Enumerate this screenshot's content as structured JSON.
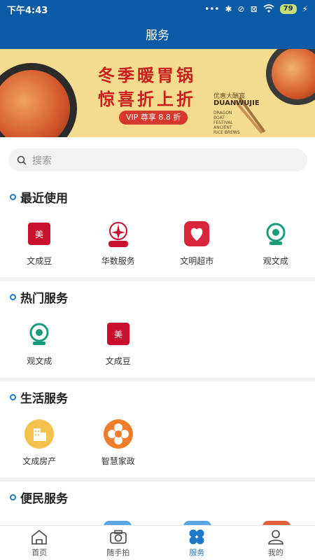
{
  "status_bar": {
    "time": "下午4:43",
    "icons": [
      "dots-icon",
      "bluetooth-icon",
      "vibrate-icon",
      "sim-icon",
      "wifi-icon",
      "battery-icon",
      "charging-icon"
    ],
    "battery": "79"
  },
  "header": {
    "title": "服务"
  },
  "banner": {
    "title_line1": "冬季暖胃锅",
    "title_line2": "惊喜折上折",
    "vip_text": "VIP 尊享 8.8 折",
    "brand_cn": "优惠大酬宾",
    "brand_en": "DUANWUJIE",
    "brand_sub": "DRAGON BOAT FESTIVAL ANCIENT RICE BREWS"
  },
  "search": {
    "placeholder": "搜索"
  },
  "sections": {
    "recent": {
      "title": "最近使用",
      "items": [
        "文成豆",
        "华数服务",
        "文明超市",
        "观文成"
      ]
    },
    "hot": {
      "title": "热门服务",
      "items": [
        "观文成",
        "文成豆"
      ]
    },
    "life": {
      "title": "生活服务",
      "items": [
        "文成房产",
        "智慧家政"
      ]
    },
    "people": {
      "title": "便民服务"
    }
  },
  "tabs": [
    {
      "label": "首页",
      "icon": "home-icon"
    },
    {
      "label": "随手拍",
      "icon": "camera-icon"
    },
    {
      "label": "服务",
      "icon": "service-icon",
      "active": true
    },
    {
      "label": "我的",
      "icon": "user-icon"
    }
  ],
  "colors": {
    "primary": "#0b5aa5",
    "accent": "#1f78c8",
    "red": "#c91e1e"
  }
}
